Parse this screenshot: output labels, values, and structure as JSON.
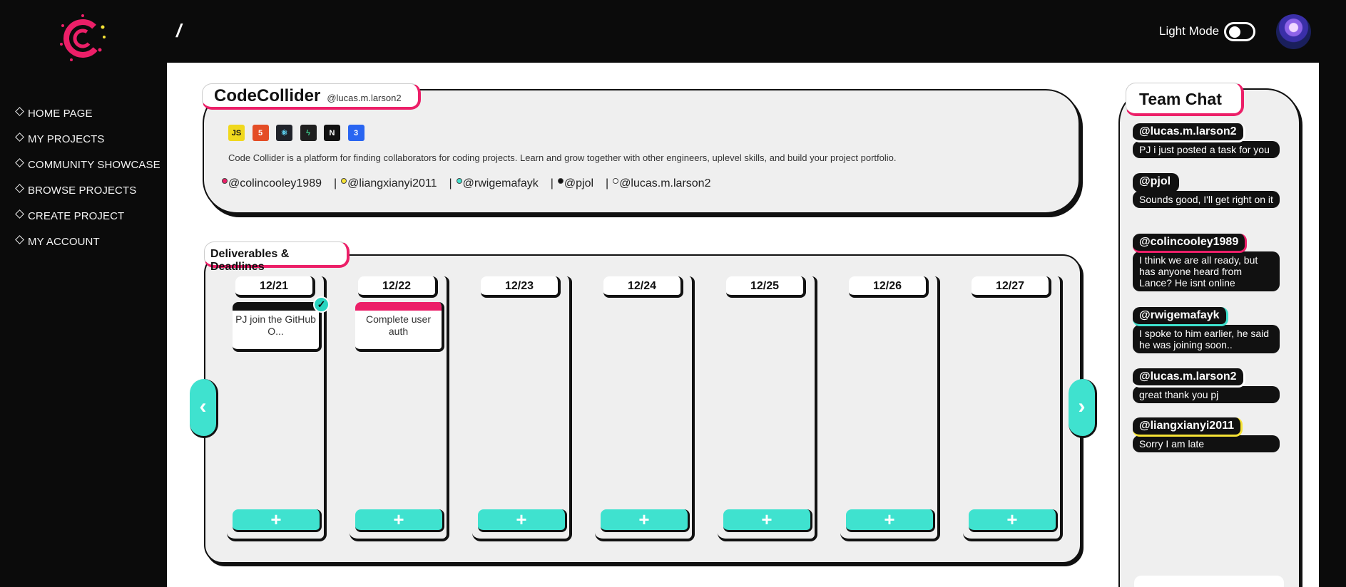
{
  "app": {
    "breadcrumb": "/"
  },
  "sidebar": {
    "items": [
      {
        "label": "HOME PAGE"
      },
      {
        "label": "MY PROJECTS"
      },
      {
        "label": "COMMUNITY SHOWCASE"
      },
      {
        "label": "BROWSE PROJECTS"
      },
      {
        "label": "CREATE PROJECT"
      },
      {
        "label": "MY ACCOUNT"
      }
    ]
  },
  "header": {
    "mode_label": "Light Mode"
  },
  "project": {
    "name": "CodeCollider",
    "owner_handle": "@lucas.m.larson2",
    "tech_icons": [
      {
        "icon": "javascript-icon",
        "text": "JS",
        "bg": "#f0d81d",
        "fg": "#111"
      },
      {
        "icon": "html5-icon",
        "text": "5",
        "bg": "#e44d26",
        "fg": "#fff"
      },
      {
        "icon": "react-icon",
        "text": "⚛",
        "bg": "#20232a",
        "fg": "#61dafb"
      },
      {
        "icon": "supabase-icon",
        "text": "ϟ",
        "bg": "#1f1f1f",
        "fg": "#3ecf8e"
      },
      {
        "icon": "nextjs-icon",
        "text": "N",
        "bg": "#111",
        "fg": "#fff"
      },
      {
        "icon": "css3-icon",
        "text": "3",
        "bg": "#2965f1",
        "fg": "#fff"
      }
    ],
    "description": "Code Collider is a platform for finding collaborators for coding projects. Learn and grow together with other engineers, uplevel skills, and build your project portfolio.",
    "members": [
      {
        "handle": "@colincooley1989",
        "color": "#ec1f68"
      },
      {
        "handle": "@liangxianyi2011",
        "color": "#f7e436"
      },
      {
        "handle": "@rwigemafayk",
        "color": "#3fe2cf"
      },
      {
        "handle": "@pjol",
        "color": "#111111"
      },
      {
        "handle": "@lucas.m.larson2",
        "color": "#ffffff"
      }
    ]
  },
  "deliverables": {
    "title": "Deliverables & Deadlines",
    "add_label": "+",
    "days": [
      {
        "date": "12/21",
        "task": "PJ join the GitHub O...",
        "task_color": "#111111",
        "done": true
      },
      {
        "date": "12/22",
        "task": "Complete user auth",
        "task_color": "#ec1f68",
        "done": false
      },
      {
        "date": "12/23"
      },
      {
        "date": "12/24"
      },
      {
        "date": "12/25"
      },
      {
        "date": "12/26"
      },
      {
        "date": "12/27"
      }
    ],
    "prev_label": "‹",
    "next_label": "›"
  },
  "chat": {
    "title": "Team Chat",
    "messages": [
      {
        "user": "@lucas.m.larson2",
        "text": "PJ i just posted a task for you",
        "accent": "#ffffff"
      },
      {
        "user": "@pjol",
        "text": "Sounds good, I'll get right on it",
        "accent": "#111111"
      },
      {
        "user": "@colincooley1989",
        "text": "I think we are all ready, but has anyone heard from Lance? He isnt online",
        "accent": "#ec1f68"
      },
      {
        "user": "@rwigemafayk",
        "text": "I spoke to him earlier, he said he was joining soon..",
        "accent": "#3fe2cf"
      },
      {
        "user": "@lucas.m.larson2",
        "text": "great thank you pj",
        "accent": "#ffffff"
      },
      {
        "user": "@liangxianyi2011",
        "text": "Sorry I am late",
        "accent": "#f7e436"
      }
    ]
  }
}
